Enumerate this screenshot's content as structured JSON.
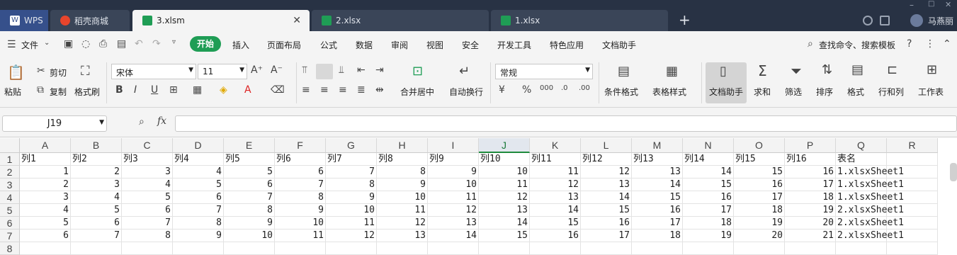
{
  "tabs": [
    {
      "label": "WPS"
    },
    {
      "label": "稻壳商城"
    },
    {
      "label": "3.xlsm"
    },
    {
      "label": "2.xlsx"
    },
    {
      "label": "1.xlsx"
    }
  ],
  "user": "马燕丽",
  "menu": {
    "file": "文件",
    "start": "开始",
    "items": [
      "插入",
      "页面布局",
      "公式",
      "数据",
      "审阅",
      "视图",
      "安全",
      "开发工具",
      "特色应用",
      "文档助手"
    ],
    "search": "查找命令、搜索模板"
  },
  "ribbon": {
    "paste": "粘贴",
    "cut": "剪切",
    "copy": "复制",
    "format_painter": "格式刷",
    "font": "宋体",
    "size": "11",
    "merge": "合并居中",
    "wrap": "自动换行",
    "number_format": "常规",
    "cond_format": "条件格式",
    "table_style": "表格样式",
    "doc_helper": "文档助手",
    "sum": "求和",
    "filter": "筛选",
    "sort": "排序",
    "format": "格式",
    "row_col": "行和列",
    "worksheet": "工作表"
  },
  "formula": {
    "cell_ref": "J19",
    "fx": "fx"
  },
  "columns": [
    "A",
    "B",
    "C",
    "D",
    "E",
    "F",
    "G",
    "H",
    "I",
    "J",
    "K",
    "L",
    "M",
    "N",
    "O",
    "P",
    "Q",
    "R"
  ],
  "rows": [
    [
      "列1",
      "列2",
      "列3",
      "列4",
      "列5",
      "列6",
      "列7",
      "列8",
      "列9",
      "列10",
      "列11",
      "列12",
      "列13",
      "列14",
      "列15",
      "列16",
      "表名",
      ""
    ],
    [
      "1",
      "2",
      "3",
      "4",
      "5",
      "6",
      "7",
      "8",
      "9",
      "10",
      "11",
      "12",
      "13",
      "14",
      "15",
      "16",
      "1.xlsxSheet1",
      ""
    ],
    [
      "2",
      "3",
      "4",
      "5",
      "6",
      "7",
      "8",
      "9",
      "10",
      "11",
      "12",
      "13",
      "14",
      "15",
      "16",
      "17",
      "1.xlsxSheet1",
      ""
    ],
    [
      "3",
      "4",
      "5",
      "6",
      "7",
      "8",
      "9",
      "10",
      "11",
      "12",
      "13",
      "14",
      "15",
      "16",
      "17",
      "18",
      "1.xlsxSheet1",
      ""
    ],
    [
      "4",
      "5",
      "6",
      "7",
      "8",
      "9",
      "10",
      "11",
      "12",
      "13",
      "14",
      "15",
      "16",
      "17",
      "18",
      "19",
      "2.xlsxSheet1",
      ""
    ],
    [
      "5",
      "6",
      "7",
      "8",
      "9",
      "10",
      "11",
      "12",
      "13",
      "14",
      "15",
      "16",
      "17",
      "18",
      "19",
      "20",
      "2.xlsxSheet1",
      ""
    ],
    [
      "6",
      "7",
      "8",
      "9",
      "10",
      "11",
      "12",
      "13",
      "14",
      "15",
      "16",
      "17",
      "18",
      "19",
      "20",
      "21",
      "2.xlsxSheet1",
      ""
    ]
  ],
  "row_numbers": [
    "1",
    "2",
    "3",
    "4",
    "5",
    "6",
    "7",
    "8"
  ]
}
